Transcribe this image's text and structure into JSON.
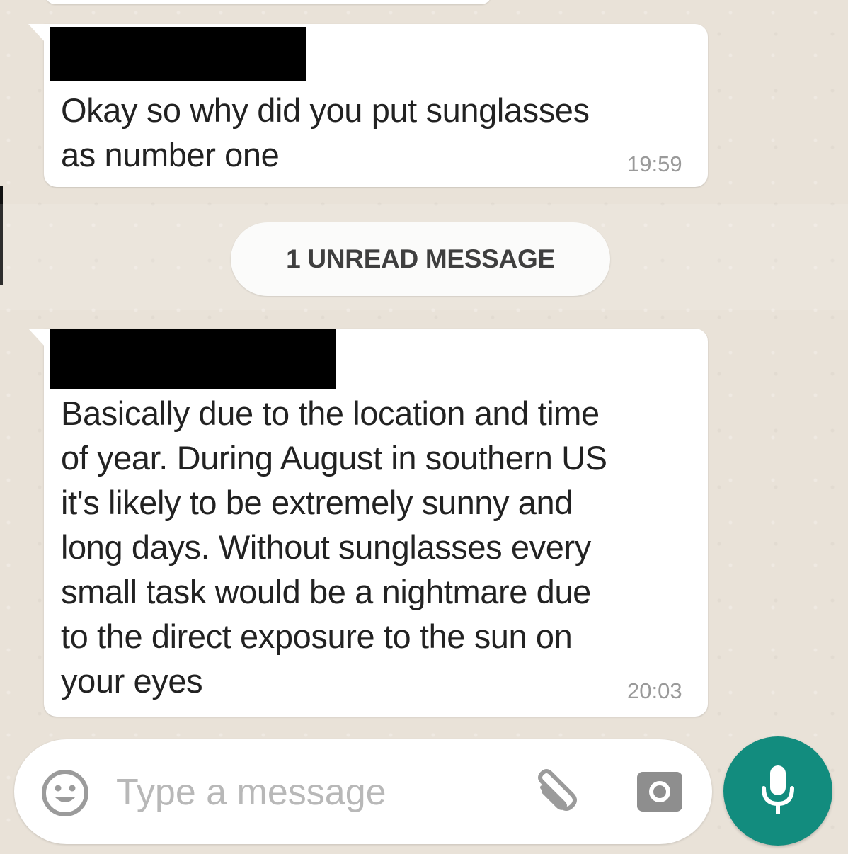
{
  "messages": [
    {
      "sender": "",
      "text": "Okay so why did you put sunglasses\nas number one",
      "time": "19:59"
    },
    {
      "sender": "",
      "text": "Basically due to the location and time\nof year. During August in southern US\nit's likely to be extremely sunny and\nlong days. Without sunglasses every\nsmall task would be a nightmare due\nto the direct exposure to the sun on\nyour eyes",
      "time": "20:03"
    }
  ],
  "unread_label": "1 UNREAD MESSAGE",
  "composer": {
    "placeholder": "Type a message",
    "value": ""
  },
  "icons": {
    "emoji": "emoji-icon",
    "attach": "paperclip-icon",
    "camera": "camera-icon",
    "mic": "microphone-icon"
  },
  "colors": {
    "chat_background": "#e9e2d8",
    "bubble": "#ffffff",
    "mic_button": "#128c7e",
    "timestamp": "#9a9a9a"
  }
}
